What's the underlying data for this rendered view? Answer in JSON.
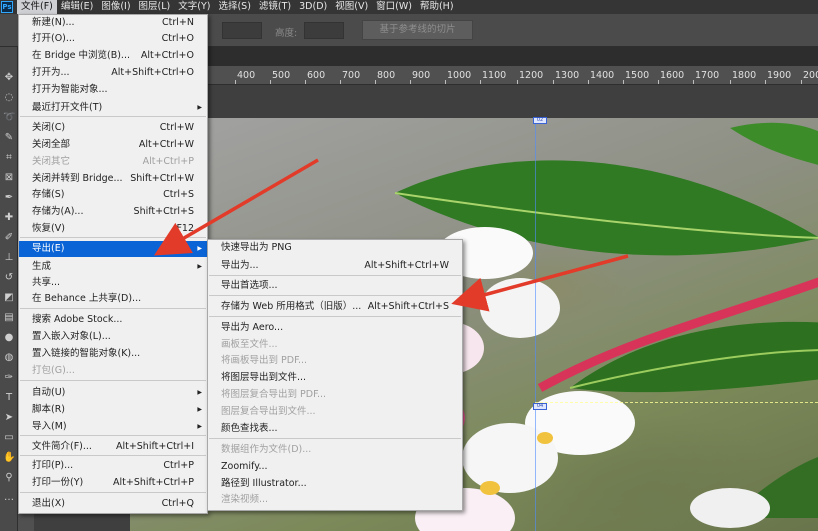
{
  "app": {
    "logo": "Ps"
  },
  "menubar": [
    {
      "label": "文件(F)",
      "active": true
    },
    {
      "label": "编辑(E)"
    },
    {
      "label": "图像(I)"
    },
    {
      "label": "图层(L)"
    },
    {
      "label": "文字(Y)"
    },
    {
      "label": "选择(S)"
    },
    {
      "label": "滤镜(T)"
    },
    {
      "label": "3D(D)"
    },
    {
      "label": "视图(V)"
    },
    {
      "label": "窗口(W)"
    },
    {
      "label": "帮助(H)"
    }
  ],
  "optionsbar": {
    "height_label": "高度:",
    "slice_button": "基于参考线的切片"
  },
  "ruler": {
    "ticks": [
      "400",
      "500",
      "600",
      "700",
      "800",
      "900",
      "1000",
      "1100",
      "1200",
      "1300",
      "1400",
      "1500",
      "1600",
      "1700",
      "1800",
      "1900",
      "2000"
    ]
  },
  "file_menu": {
    "items": [
      {
        "label": "新建(N)...",
        "shortcut": "Ctrl+N"
      },
      {
        "label": "打开(O)...",
        "shortcut": "Ctrl+O"
      },
      {
        "label": "在 Bridge 中浏览(B)...",
        "shortcut": "Alt+Ctrl+O"
      },
      {
        "label": "打开为...",
        "shortcut": "Alt+Shift+Ctrl+O"
      },
      {
        "label": "打开为智能对象..."
      },
      {
        "label": "最近打开文件(T)",
        "submenu": true
      },
      {
        "label": "关闭(C)",
        "shortcut": "Ctrl+W"
      },
      {
        "label": "关闭全部",
        "shortcut": "Alt+Ctrl+W"
      },
      {
        "label": "关闭其它",
        "shortcut": "Alt+Ctrl+P",
        "disabled": true
      },
      {
        "label": "关闭并转到 Bridge...",
        "shortcut": "Shift+Ctrl+W"
      },
      {
        "label": "存储(S)",
        "shortcut": "Ctrl+S"
      },
      {
        "label": "存储为(A)...",
        "shortcut": "Shift+Ctrl+S"
      },
      {
        "label": "恢复(V)",
        "shortcut": "F12"
      },
      {
        "label": "导出(E)",
        "submenu": true,
        "highlighted": true
      },
      {
        "label": "生成",
        "submenu": true
      },
      {
        "label": "共享..."
      },
      {
        "label": "在 Behance 上共享(D)..."
      },
      {
        "label": "搜索 Adobe Stock..."
      },
      {
        "label": "置入嵌入对象(L)..."
      },
      {
        "label": "置入链接的智能对象(K)..."
      },
      {
        "label": "打包(G)...",
        "disabled": true
      },
      {
        "label": "自动(U)",
        "submenu": true
      },
      {
        "label": "脚本(R)",
        "submenu": true
      },
      {
        "label": "导入(M)",
        "submenu": true
      },
      {
        "label": "文件简介(F)...",
        "shortcut": "Alt+Shift+Ctrl+I"
      },
      {
        "label": "打印(P)...",
        "shortcut": "Ctrl+P"
      },
      {
        "label": "打印一份(Y)",
        "shortcut": "Alt+Shift+Ctrl+P"
      },
      {
        "label": "退出(X)",
        "shortcut": "Ctrl+Q"
      }
    ]
  },
  "export_menu": {
    "items": [
      {
        "label": "快速导出为 PNG"
      },
      {
        "label": "导出为...",
        "shortcut": "Alt+Shift+Ctrl+W"
      },
      {
        "label": "导出首选项..."
      },
      {
        "label": "存储为 Web 所用格式（旧版）...",
        "shortcut": "Alt+Shift+Ctrl+S"
      },
      {
        "label": "导出为 Aero..."
      },
      {
        "label": "画板至文件...",
        "disabled": true
      },
      {
        "label": "将画板导出到 PDF...",
        "disabled": true
      },
      {
        "label": "将图层导出到文件..."
      },
      {
        "label": "将图层复合导出到 PDF...",
        "disabled": true
      },
      {
        "label": "图层复合导出到文件...",
        "disabled": true
      },
      {
        "label": "颜色查找表..."
      },
      {
        "label": "数据组作为文件(D)...",
        "disabled": true
      },
      {
        "label": "Zoomify..."
      },
      {
        "label": "路径到 Illustrator..."
      },
      {
        "label": "渲染视频...",
        "disabled": true
      }
    ]
  },
  "colors": {
    "highlight": "#0a64d6",
    "arrow": "#e23b2a"
  }
}
